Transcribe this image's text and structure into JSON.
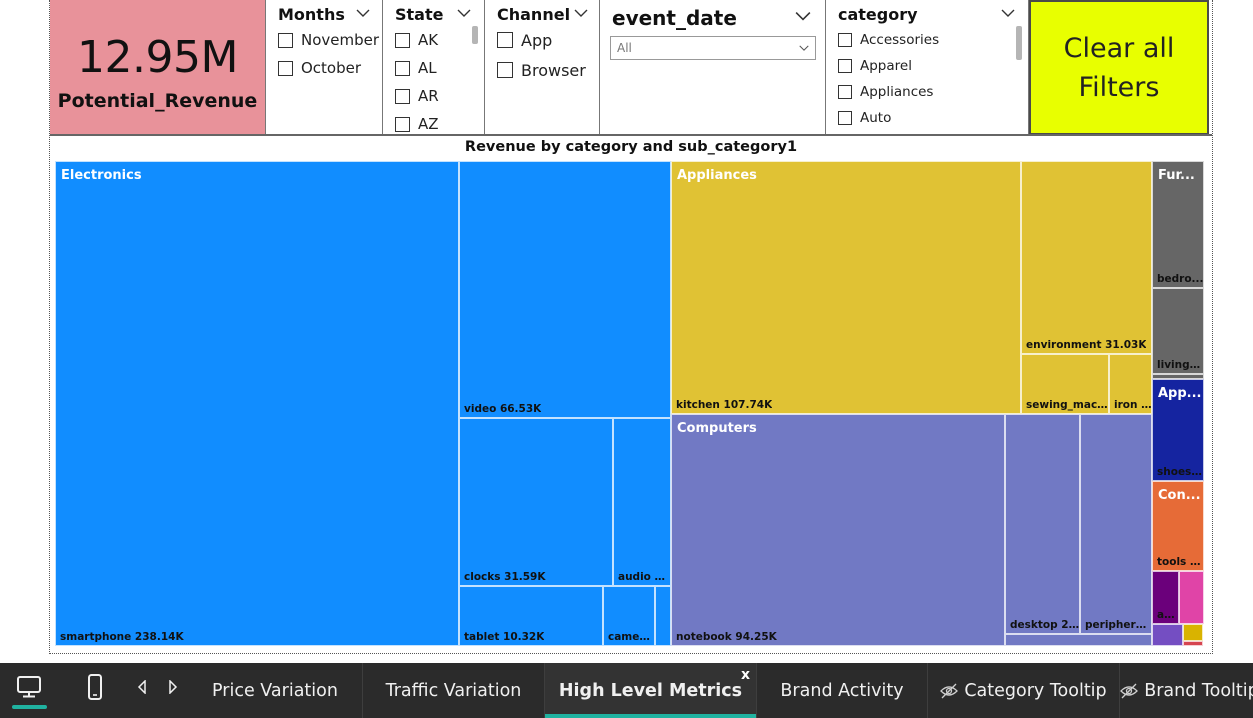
{
  "kpi": {
    "value": "12.95M",
    "label": "Potential_Revenue"
  },
  "slicers": {
    "months": {
      "title": "Months",
      "items": [
        "November",
        "October"
      ]
    },
    "state": {
      "title": "State",
      "items": [
        "AK",
        "AL",
        "AR",
        "AZ"
      ]
    },
    "channel": {
      "title": "Channel",
      "items": [
        "App",
        "Browser"
      ]
    },
    "event_date": {
      "title": "event_date",
      "value": "All"
    },
    "category": {
      "title": "category",
      "items": [
        "Accessories",
        "Apparel",
        "Appliances",
        "Auto"
      ]
    }
  },
  "clear_button": {
    "line1": "Clear all",
    "line2": "Filters"
  },
  "chart_title": "Revenue by category and sub_category1",
  "treemap": {
    "tiles": [
      {
        "category": "Electronics",
        "sub": "smartphone 238.14K",
        "color": "#118dff"
      },
      {
        "category": "",
        "sub": "video 66.53K",
        "color": "#118dff"
      },
      {
        "category": "",
        "sub": "clocks 31.59K",
        "color": "#118dff"
      },
      {
        "category": "",
        "sub": "audio 1...",
        "color": "#118dff"
      },
      {
        "category": "",
        "sub": "tablet 10.32K",
        "color": "#118dff"
      },
      {
        "category": "",
        "sub": "camera...",
        "color": "#118dff"
      },
      {
        "category": "",
        "sub": "",
        "color": "#118dff"
      },
      {
        "category": "Appliances",
        "sub": "kitchen 107.74K",
        "color": "#e0c234"
      },
      {
        "category": "",
        "sub": "environment 31.03K",
        "color": "#e0c234"
      },
      {
        "category": "",
        "sub": "sewing_machi...",
        "color": "#e0c234"
      },
      {
        "category": "",
        "sub": "iron ...",
        "color": "#e0c234"
      },
      {
        "category": "Computers",
        "sub": "notebook 94.25K",
        "color": "#7179c4"
      },
      {
        "category": "",
        "sub": "desktop 20....",
        "color": "#7179c4"
      },
      {
        "category": "",
        "sub": "peripherals...",
        "color": "#7179c4"
      },
      {
        "category": "",
        "sub": "",
        "color": "#7179c4"
      },
      {
        "category": "Fur...",
        "sub": "bedro...",
        "color": "#666666"
      },
      {
        "category": "",
        "sub": "living_r...",
        "color": "#666666"
      },
      {
        "category": "",
        "sub": "",
        "color": "#666666"
      },
      {
        "category": "App...",
        "sub": "shoes ...",
        "color": "#1524a0"
      },
      {
        "category": "Con...",
        "sub": "tools 5...",
        "color": "#e66b37"
      },
      {
        "category": "",
        "sub": "ac...",
        "color": "#6b007b"
      },
      {
        "category": "",
        "sub": "",
        "color": "#e044a7"
      },
      {
        "category": "",
        "sub": "",
        "color": "#744ec2"
      },
      {
        "category": "",
        "sub": "",
        "color": "#d9b300"
      },
      {
        "category": "",
        "sub": "",
        "color": "#d64550"
      }
    ]
  },
  "taskbar": {
    "tabs": [
      {
        "label": "Price Variation",
        "active": false,
        "hidden": false
      },
      {
        "label": "Traffic Variation",
        "active": false,
        "hidden": false
      },
      {
        "label": "High Level Metrics",
        "active": true,
        "hidden": false,
        "close": "x"
      },
      {
        "label": "Brand Activity",
        "active": false,
        "hidden": false
      },
      {
        "label": "Category Tooltip",
        "active": false,
        "hidden": true
      },
      {
        "label": "Brand Tooltip",
        "active": false,
        "hidden": true
      }
    ]
  }
}
